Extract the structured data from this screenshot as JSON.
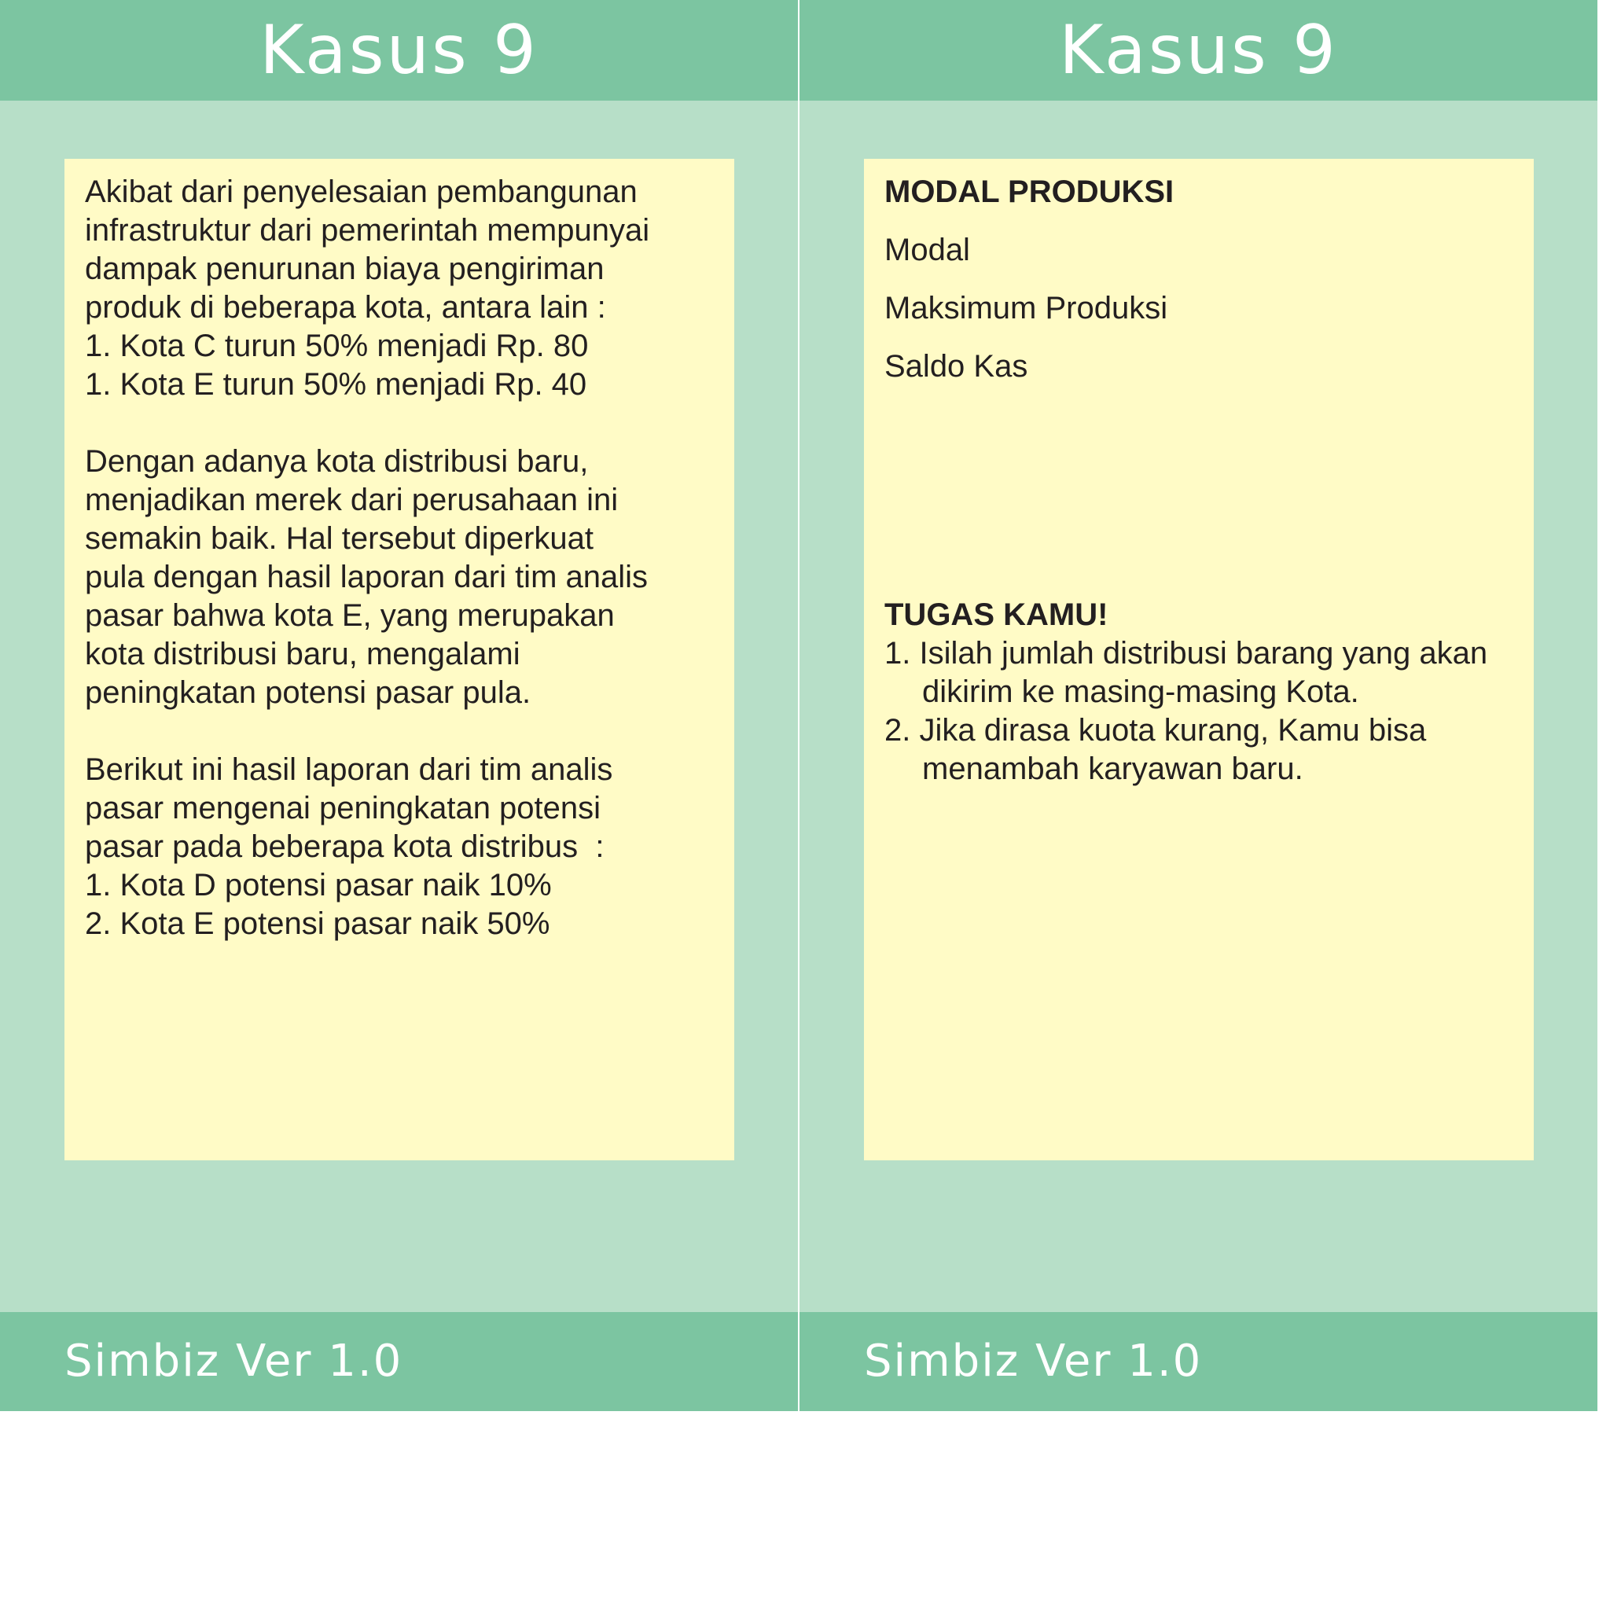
{
  "left_card": {
    "header": "Kasus 9",
    "paragraph1": [
      "Akibat dari penyelesaian pembangunan",
      "infrastruktur dari pemerintah mempunyai",
      "dampak penurunan biaya pengiriman",
      "produk di beberapa kota, antara lain :",
      "1. Kota C turun 50% menjadi Rp. 80",
      "1. Kota E turun 50% menjadi Rp. 40"
    ],
    "paragraph2": [
      "Dengan adanya kota distribusi baru,",
      "menjadikan merek dari perusahaan ini",
      "semakin baik. Hal tersebut diperkuat",
      "pula dengan hasil laporan dari tim analis",
      "pasar bahwa kota E, yang merupakan",
      "kota distribusi baru, mengalami",
      "peningkatan potensi pasar pula."
    ],
    "paragraph3": [
      "Berikut ini hasil laporan dari tim analis",
      "pasar mengenai peningkatan potensi",
      "pasar pada beberapa kota distribus  :",
      "1. Kota D potensi pasar naik 10%",
      "2. Kota E potensi pasar naik 50%"
    ],
    "footer": "Simbiz Ver 1.0"
  },
  "right_card": {
    "header": "Kasus 9",
    "section_title": "MODAL PRODUKSI",
    "fields": [
      "Modal",
      "Maksimum Produksi",
      "Saldo Kas"
    ],
    "tasks_title": "TUGAS KAMU!",
    "tasks": [
      "1. Isilah jumlah distribusi barang yang akan dikirim ke masing-masing Kota.",
      "2. Jika dirasa kuota kurang, Kamu bisa menambah karyawan baru."
    ],
    "footer": "Simbiz Ver 1.0"
  }
}
